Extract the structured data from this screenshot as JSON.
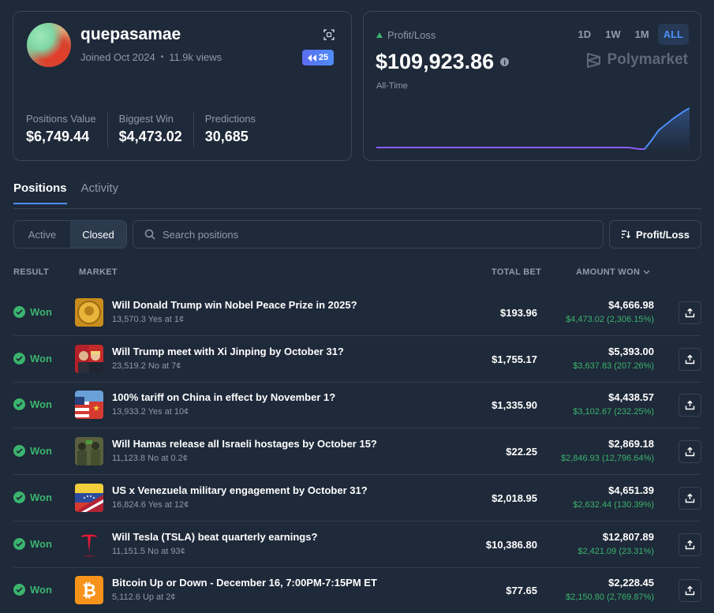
{
  "profile": {
    "username": "quepasamae",
    "joined": "Joined Oct 2024",
    "separator": "•",
    "views": "11.9k views",
    "rank_badge": "25",
    "stats": [
      {
        "label": "Positions Value",
        "value": "$6,749.44"
      },
      {
        "label": "Biggest Win",
        "value": "$4,473.02"
      },
      {
        "label": "Predictions",
        "value": "30,685"
      }
    ]
  },
  "pnl": {
    "label": "Profit/Loss",
    "value": "$109,923.86",
    "info": "i",
    "period": "All-Time",
    "ranges": [
      "1D",
      "1W",
      "1M",
      "ALL"
    ],
    "active_range": "ALL",
    "brand": "Polymarket",
    "trend_colors": {
      "flat": "#8b5cf6",
      "rise": "#4e8df6",
      "positive": "#3bb46e"
    }
  },
  "tabs": {
    "positions": "Positions",
    "activity": "Activity"
  },
  "filters": {
    "active": "Active",
    "closed": "Closed"
  },
  "search": {
    "placeholder": "Search positions"
  },
  "sort": {
    "label": "Profit/Loss"
  },
  "table": {
    "headers": {
      "result": "RESULT",
      "market": "MARKET",
      "total_bet": "TOTAL BET",
      "amount_won": "AMOUNT WON"
    },
    "rows": [
      {
        "result": "Won",
        "thumb": "nobel-medal",
        "title": "Will Donald Trump win Nobel Peace Prize in 2025?",
        "sub": "13,570.3 Yes at 1¢",
        "bet": "$193.96",
        "won": "$4,666.98",
        "profit": "$4,473.02 (2,306.15%)"
      },
      {
        "result": "Won",
        "thumb": "trump-xi",
        "title": "Will Trump meet with Xi Jinping by October 31?",
        "sub": "23,519.2 No at 7¢",
        "bet": "$1,755.17",
        "won": "$5,393.00",
        "profit": "$3,637.83 (207.26%)"
      },
      {
        "result": "Won",
        "thumb": "us-china-flags",
        "title": "100% tariff on China in effect by November 1?",
        "sub": "13,933.2 Yes at 10¢",
        "bet": "$1,335.90",
        "won": "$4,438.57",
        "profit": "$3,102.67 (232.25%)"
      },
      {
        "result": "Won",
        "thumb": "hamas-fighters",
        "title": "Will Hamas release all Israeli hostages by October 15?",
        "sub": "11,123.8 No at 0.2¢",
        "bet": "$22.25",
        "won": "$2,869.18",
        "profit": "$2,846.93 (12,796.64%)"
      },
      {
        "result": "Won",
        "thumb": "us-venezuela-flags",
        "title": "US x Venezuela military engagement by October 31?",
        "sub": "16,824.6 Yes at 12¢",
        "bet": "$2,018.95",
        "won": "$4,651.39",
        "profit": "$2,632.44 (130.39%)"
      },
      {
        "result": "Won",
        "thumb": "tesla-logo",
        "title": "Will Tesla (TSLA) beat quarterly earnings?",
        "sub": "11,151.5 No at 93¢",
        "bet": "$10,386.80",
        "won": "$12,807.89",
        "profit": "$2,421.09 (23.31%)"
      },
      {
        "result": "Won",
        "thumb": "bitcoin-logo",
        "title": "Bitcoin Up or Down - December 16, 7:00PM-7:15PM ET",
        "sub": "5,112.6 Up at 2¢",
        "bet": "$77.65",
        "won": "$2,228.45",
        "profit": "$2,150.80 (2,769.87%)"
      }
    ]
  }
}
